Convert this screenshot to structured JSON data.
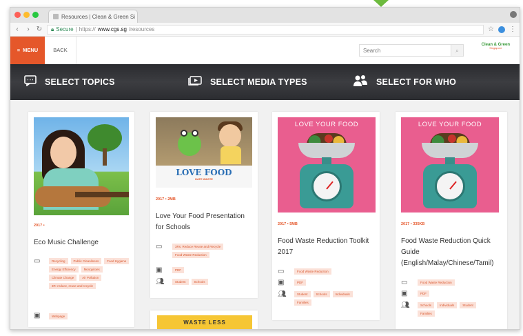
{
  "browser": {
    "tab_title": "Resources | Clean & Green Si",
    "tab_close": "×",
    "url_secure": "Secure",
    "url_scheme": "https://",
    "url_host": "www.cgs.sg",
    "url_path": "/resources",
    "traffic_lights": [
      "#fd5f57",
      "#febc2e",
      "#27c840"
    ]
  },
  "header": {
    "menu_label": "MENU",
    "back_label": "BACK",
    "search_placeholder": "Search",
    "logo_line1": "Clean & Green",
    "logo_line2": "Singapore"
  },
  "filters": [
    {
      "label": "SELECT TOPICS",
      "icon": "chat-icon"
    },
    {
      "label": "SELECT MEDIA TYPES",
      "icon": "media-icon"
    },
    {
      "label": "SELECT FOR WHO",
      "icon": "people-icon"
    }
  ],
  "cards": [
    {
      "meta": "2017 •",
      "title": "Eco Music Challenge",
      "topics": [
        "Recycling",
        "Public Cleanliness",
        "Food Hygiene",
        "Energy Efficiency",
        "Mosquitoes",
        "Climate Change",
        "Air Pollution",
        "3R: reduce, reuse and recycle"
      ],
      "media": [
        "Webpage"
      ]
    },
    {
      "meta": "2017 •  2MB",
      "title": "Love Your Food Presentation for Schools",
      "image_title": "LOVE FOOD",
      "image_sub": "HATE WASTE",
      "topics": [
        "3Rs: Reduce Reuse and Recycle",
        "Food Waste Reduction"
      ],
      "media": [
        "PDF"
      ],
      "audience": [
        "Student",
        "Schools"
      ]
    },
    {
      "meta": "2017 •  5MB",
      "title": "Food Waste Reduction Toolkit 2017",
      "image_title": "LOVE YOUR FOOD",
      "topics": [
        "Food Waste Reduction"
      ],
      "media": [
        "PDF"
      ],
      "audience": [
        "Student",
        "Schools",
        "Individuals",
        "Families"
      ]
    },
    {
      "meta": "2017 •  335KB",
      "title": "Food Waste Reduction Quick Guide (English/Malay/Chinese/Tamil)",
      "image_title": "LOVE YOUR FOOD",
      "topics": [
        "Food Waste Reduction"
      ],
      "media": [
        "PDF"
      ],
      "audience": [
        "Schools",
        "Individuals",
        "Student",
        "Families"
      ]
    },
    {
      "banner": "WASTE LESS"
    }
  ]
}
